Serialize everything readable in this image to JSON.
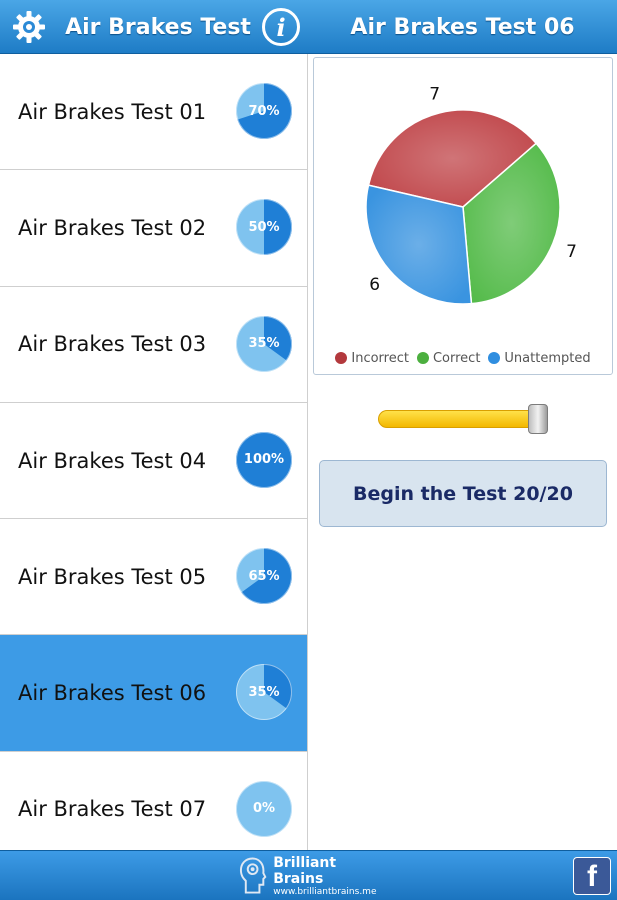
{
  "header": {
    "title": "Air Brakes Test",
    "info_glyph": "i",
    "right_title": "Air Brakes Test 06",
    "settings_icon": "gear-icon"
  },
  "tests": [
    {
      "label": "Air Brakes Test 01",
      "percent": 70,
      "percent_text": "70%",
      "selected": false
    },
    {
      "label": "Air Brakes Test 02",
      "percent": 50,
      "percent_text": "50%",
      "selected": false
    },
    {
      "label": "Air Brakes Test 03",
      "percent": 35,
      "percent_text": "35%",
      "selected": false
    },
    {
      "label": "Air Brakes Test 04",
      "percent": 100,
      "percent_text": "100%",
      "selected": false
    },
    {
      "label": "Air Brakes Test 05",
      "percent": 65,
      "percent_text": "65%",
      "selected": false
    },
    {
      "label": "Air Brakes Test 06",
      "percent": 35,
      "percent_text": "35%",
      "selected": true
    },
    {
      "label": "Air Brakes Test 07",
      "percent": 0,
      "percent_text": "0%",
      "selected": false
    }
  ],
  "chart_data": {
    "type": "pie",
    "values": [
      7,
      7,
      6
    ],
    "labels": [
      "Incorrect",
      "Correct",
      "Unattempted"
    ],
    "value_labels": [
      "7",
      "7",
      "6"
    ],
    "colors": [
      "#c0464a",
      "#55bb4b",
      "#3a94e0"
    ],
    "legend_position": "bottom"
  },
  "legend": [
    {
      "label": "Incorrect",
      "color": "#b3393d"
    },
    {
      "label": "Correct",
      "color": "#4caf3f"
    },
    {
      "label": "Unattempted",
      "color": "#2f8ee0"
    }
  ],
  "slider": {
    "level": 1.0
  },
  "begin_button": {
    "label": "Begin the Test 20/20"
  },
  "footer": {
    "brand_name": "Brilliant Brains",
    "brand_url": "www.brilliantbrains.me",
    "facebook_glyph": "f"
  },
  "colors": {
    "header": "#2b8ad6",
    "selected_row": "#3d9be6",
    "button_text": "#1a2a66"
  }
}
